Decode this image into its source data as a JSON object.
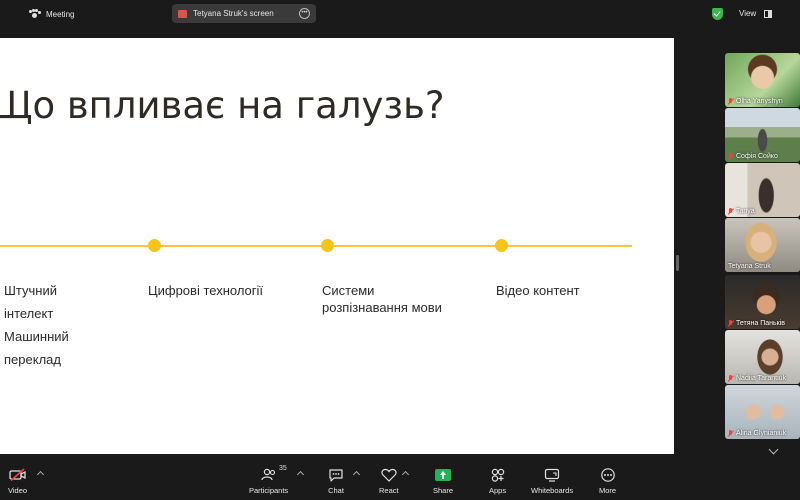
{
  "topbar": {
    "meeting_label": "Meeting",
    "share_label": "Tetyana Struk's screen",
    "view_label": "View"
  },
  "slide": {
    "title": "Що впливає на галузь?",
    "columns": [
      [
        "Штучний",
        "інтелект",
        "Машинний",
        "переклад"
      ],
      [
        "Цифрові технології"
      ],
      [
        "Системи",
        "розпізнавання мови"
      ],
      [
        "Відео контент"
      ]
    ],
    "accent_color": "#f5c518"
  },
  "participants_tiles": [
    {
      "name": "Olha Yanyshyn",
      "muted": true
    },
    {
      "name": "Софія Сойко",
      "muted": true
    },
    {
      "name": "Tanya",
      "muted": true
    },
    {
      "name": "Tetyana Struk",
      "muted": false,
      "active": true
    },
    {
      "name": "Тетяна Паньків",
      "muted": true
    },
    {
      "name": "Nadiia Tarantiuk",
      "muted": true
    },
    {
      "name": "Alina Glynianiuk",
      "muted": true
    }
  ],
  "toolbar": {
    "video_label": "Video",
    "participants_label": "Participants",
    "participants_count": "35",
    "chat_label": "Chat",
    "react_label": "React",
    "share_label": "Share",
    "apps_label": "Apps",
    "whiteboards_label": "Whiteboards",
    "more_label": "More"
  }
}
